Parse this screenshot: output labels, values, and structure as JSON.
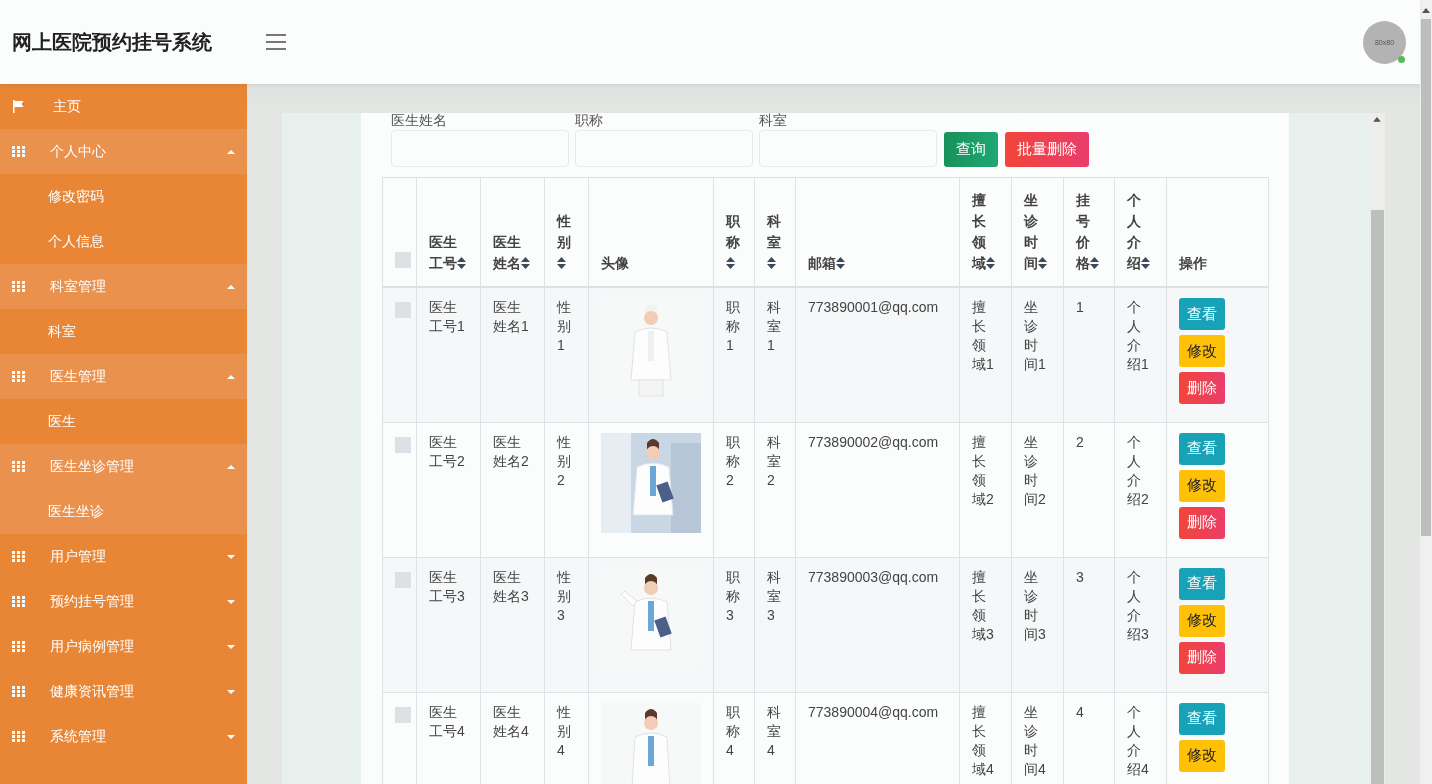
{
  "header": {
    "title": "网上医院预约挂号系统",
    "avatar_text": "80x80",
    "online": true
  },
  "sidebar": {
    "items": [
      {
        "label": "主页",
        "kind": "link",
        "selected": false
      },
      {
        "label": "个人中心",
        "kind": "group",
        "expanded": true,
        "children": [
          {
            "label": "修改密码",
            "selected": false
          },
          {
            "label": "个人信息",
            "selected": false
          }
        ]
      },
      {
        "label": "科室管理",
        "kind": "group",
        "expanded": true,
        "children": [
          {
            "label": "科室",
            "selected": false
          }
        ]
      },
      {
        "label": "医生管理",
        "kind": "group",
        "expanded": true,
        "children": [
          {
            "label": "医生",
            "selected": false
          }
        ]
      },
      {
        "label": "医生坐诊管理",
        "kind": "group",
        "expanded": true,
        "children": [
          {
            "label": "医生坐诊",
            "selected": true
          }
        ]
      },
      {
        "label": "用户管理",
        "kind": "group",
        "expanded": false
      },
      {
        "label": "预约挂号管理",
        "kind": "group",
        "expanded": false
      },
      {
        "label": "用户病例管理",
        "kind": "group",
        "expanded": false
      },
      {
        "label": "健康资讯管理",
        "kind": "group",
        "expanded": false
      },
      {
        "label": "系统管理",
        "kind": "group",
        "expanded": false
      }
    ]
  },
  "search": {
    "fields": [
      {
        "label": "医生姓名"
      },
      {
        "label": "职称"
      },
      {
        "label": "科室"
      }
    ],
    "buttons": [
      {
        "label": "查询",
        "kind": "search"
      },
      {
        "label": "批量删除",
        "kind": "danger"
      }
    ]
  },
  "table": {
    "select_all": {
      "checked": false
    },
    "columns": [
      {
        "label": "医生工号",
        "sortable": true
      },
      {
        "label": "医生姓名",
        "sortable": true
      },
      {
        "label": "性别",
        "sortable": true
      },
      {
        "label": "头像",
        "sortable": false
      },
      {
        "label": "职称",
        "sortable": true
      },
      {
        "label": "科室",
        "sortable": true
      },
      {
        "label": "邮箱",
        "sortable": true
      },
      {
        "label": "擅长领域",
        "sortable": true
      },
      {
        "label": "坐诊时间",
        "sortable": true
      },
      {
        "label": "挂号价格",
        "sortable": true
      },
      {
        "label": "个人介绍",
        "sortable": true
      },
      {
        "label": "操作",
        "sortable": false
      }
    ],
    "rows": [
      {
        "checked": false,
        "cells": [
          "医生工号1",
          "医生姓名1",
          "性别1",
          {
            "kind": "picture"
          },
          "职称1",
          "科室1",
          "773890001@qq.com",
          "擅长领域1",
          "坐诊时间1",
          "1",
          "个人介绍1"
        ],
        "actions": [
          {
            "label": "查看",
            "kind": "view"
          },
          {
            "label": "修改",
            "kind": "edit"
          },
          {
            "label": "删除",
            "kind": "delete"
          }
        ]
      },
      {
        "checked": false,
        "cells": [
          "医生工号2",
          "医生姓名2",
          "性别2",
          {
            "kind": "picture"
          },
          "职称2",
          "科室2",
          "773890002@qq.com",
          "擅长领域2",
          "坐诊时间2",
          "2",
          "个人介绍2"
        ],
        "actions": [
          {
            "label": "查看",
            "kind": "view"
          },
          {
            "label": "修改",
            "kind": "edit"
          },
          {
            "label": "删除",
            "kind": "delete"
          }
        ]
      },
      {
        "checked": false,
        "cells": [
          "医生工号3",
          "医生姓名3",
          "性别3",
          {
            "kind": "picture"
          },
          "职称3",
          "科室3",
          "773890003@qq.com",
          "擅长领域3",
          "坐诊时间3",
          "3",
          "个人介绍3"
        ],
        "actions": [
          {
            "label": "查看",
            "kind": "view"
          },
          {
            "label": "修改",
            "kind": "edit"
          },
          {
            "label": "删除",
            "kind": "delete"
          }
        ]
      },
      {
        "checked": false,
        "cells": [
          "医生工号4",
          "医生姓名4",
          "性别4",
          {
            "kind": "picture"
          },
          "职称4",
          "科室4",
          "773890004@qq.com",
          "擅长领域4",
          "坐诊时间4",
          "4",
          "个人介绍4"
        ],
        "actions": [
          {
            "label": "查看",
            "kind": "view"
          },
          {
            "label": "修改",
            "kind": "edit"
          }
        ]
      }
    ]
  }
}
